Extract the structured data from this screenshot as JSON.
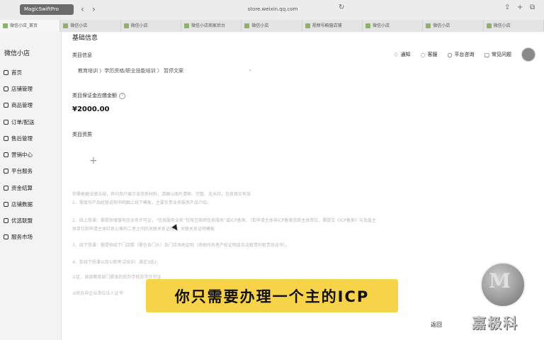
{
  "browser": {
    "extension_label": "MagicSwiftPro",
    "url": "store.weixin.qq.com",
    "tabs": [
      "微信小店_首页",
      "微信小店",
      "微信小店",
      "微信小店商家后台",
      "微信小店",
      "视频号橱窗店铺",
      "微信小店",
      "微信小店",
      "微信小店"
    ]
  },
  "sidebar": {
    "app_title": "微信小店",
    "items": [
      "首页",
      "店铺管理",
      "商品管理",
      "订单/配送",
      "售后管理",
      "营销中心",
      "平台服务",
      "资金结算",
      "店铺数据",
      "优选联盟",
      "服务市场"
    ]
  },
  "header": {
    "section_title": "基础信息",
    "notify": "通知",
    "service": "客服",
    "platform": "平台咨询",
    "faq": "常见问题"
  },
  "form": {
    "category_label": "类目信息",
    "category_path": "教育培训 〉学历资格/职业技能培训 〉 暂停文案",
    "deposit_label": "类目保证金应缴金额",
    "deposit_value": "¥2000.00",
    "qualification_label": "类目资质"
  },
  "notes": [
    "你需根据法律法规，将向用户展示该资质材料，请确认图片清晰、完整、无水印，信息真实有效",
    "1、需填写产品经营说明书明细上线下模板，主要负责业务服务产品介绍。",
    "2、线上授课：需提供增值电信业务许可证，“信息服务业务”仅限互联网信息服务“或ICP备案，（若申请主体非ICP备案资质主体单位，需提交《ICP备案》与加盖主",
    "体单位和申请主体红色公章的二者之间的关联关系证明）；关联关系证明模板",
    "3、线下授课：需提供线下门店照（需包含门头）及门店场地证明（场地所有者产权证明或合法租赁的租赁协议书）。",
    "4、若线下授课以及公职考试培训：满足3选1:",
    "①区、县级教育部门颁发的民办学校办学许可证",
    "②民办非企业单位法人证书"
  ],
  "actions": {
    "back": "返回"
  },
  "overlay": {
    "caption": "你只需要办理一个主的ICP",
    "watermark": "嘉极科"
  }
}
